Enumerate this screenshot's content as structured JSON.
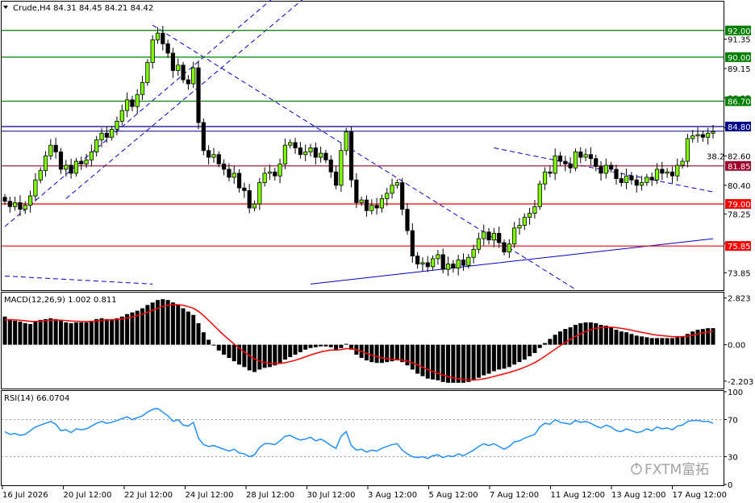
{
  "header": {
    "symbol_line": "Crude,H4  84.31 84.45 84.21 84.42"
  },
  "brand": {
    "logo_text": "FXTM富拓"
  },
  "chart_data": [
    {
      "type": "candlestick",
      "title": "Crude,H4",
      "ohlc_last": {
        "open": 84.31,
        "high": 84.45,
        "low": 84.21,
        "close": 84.42
      },
      "ylim": [
        72.6,
        94.1
      ],
      "y_ticks": [
        "91.35",
        "89.15",
        "86.95",
        "84.72",
        "82.60",
        "80.40",
        "78.25",
        "76.05",
        "73.85"
      ],
      "x_ticks": [
        "16 Jul 2026",
        "20 Jul 12:00",
        "22 Jul 12:00",
        "24 Jul 12:00",
        "28 Jul 12:00",
        "30 Jul 12:00",
        "3 Aug 12:00",
        "5 Aug 12:00",
        "7 Aug 12:00",
        "11 Aug 12:00",
        "13 Aug 12:00",
        "17 Aug 12:00"
      ],
      "horizontal_levels": [
        {
          "label": "92.00",
          "value": 92.0,
          "color": "#008000"
        },
        {
          "label": "90.00",
          "value": 90.0,
          "color": "#008000"
        },
        {
          "label": "86.70",
          "value": 86.7,
          "color": "#008000"
        },
        {
          "label": "84.80",
          "value": 84.8,
          "color": "#00008b"
        },
        {
          "label": "81.85",
          "value": 81.85,
          "color": "#a0002a"
        },
        {
          "label": "79.00",
          "value": 79.0,
          "color": "#ff0000"
        },
        {
          "label": "75.85",
          "value": 75.85,
          "color": "#ff0000"
        }
      ],
      "annotations": [
        "38.2"
      ],
      "closes": [
        79.2,
        78.8,
        79.1,
        78.6,
        78.9,
        79.6,
        80.8,
        81.5,
        82.6,
        83.4,
        82.9,
        81.6,
        81.9,
        81.3,
        82.2,
        82.0,
        82.3,
        82.9,
        83.8,
        84.3,
        84.0,
        84.6,
        85.2,
        86.0,
        86.8,
        86.3,
        87.2,
        88.1,
        89.6,
        91.3,
        91.8,
        91.0,
        90.3,
        89.0,
        89.4,
        88.3,
        88.0,
        89.2,
        85.1,
        83.0,
        82.5,
        82.7,
        82.0,
        81.6,
        81.0,
        81.3,
        80.2,
        80.0,
        78.7,
        79.0,
        80.6,
        81.3,
        81.4,
        81.1,
        82.0,
        83.4,
        83.6,
        83.2,
        82.7,
        82.9,
        83.2,
        82.5,
        82.8,
        82.3,
        81.4,
        80.4,
        83.0,
        84.4,
        80.8,
        79.1,
        79.3,
        78.5,
        78.9,
        78.7,
        79.4,
        79.8,
        80.4,
        80.6,
        78.6,
        77.0,
        75.1,
        74.5,
        74.6,
        74.3,
        74.9,
        75.2,
        74.1,
        74.5,
        74.2,
        74.8,
        74.4,
        75.0,
        75.6,
        76.4,
        76.9,
        76.3,
        76.8,
        76.1,
        75.4,
        76.0,
        77.2,
        77.4,
        78.0,
        78.3,
        78.8,
        80.5,
        81.4,
        81.3,
        82.6,
        82.2,
        82.0,
        81.7,
        82.9,
        82.5,
        82.7,
        82.4,
        81.8,
        81.3,
        81.9,
        81.6,
        80.9,
        80.6,
        81.1,
        80.8,
        80.4,
        80.6,
        81.0,
        80.8,
        81.6,
        81.3,
        81.4,
        81.1,
        81.9,
        82.2,
        83.9,
        84.1,
        84.2,
        84.0,
        84.3,
        84.42
      ]
    },
    {
      "type": "histogram-line",
      "title": "MACD(12,26,9) 1.002 0.811",
      "ylim": [
        -2.6,
        3.1
      ],
      "y_ticks": [
        "2.823",
        "0.00",
        "-2.203"
      ],
      "series": [
        {
          "name": "MACD",
          "values": [
            1.7,
            1.55,
            1.45,
            1.4,
            1.3,
            1.25,
            1.4,
            1.5,
            1.55,
            1.6,
            1.55,
            1.45,
            1.35,
            1.3,
            1.35,
            1.35,
            1.35,
            1.45,
            1.55,
            1.6,
            1.55,
            1.55,
            1.6,
            1.7,
            1.85,
            1.95,
            2.05,
            2.2,
            2.4,
            2.55,
            2.7,
            2.75,
            2.7,
            2.55,
            2.4,
            2.2,
            2.0,
            1.8,
            1.3,
            0.75,
            0.3,
            -0.05,
            -0.35,
            -0.6,
            -0.8,
            -1.0,
            -1.2,
            -1.35,
            -1.55,
            -1.65,
            -1.5,
            -1.4,
            -1.35,
            -1.25,
            -1.1,
            -0.9,
            -0.75,
            -0.6,
            -0.45,
            -0.3,
            -0.2,
            -0.15,
            -0.1,
            -0.1,
            -0.15,
            -0.3,
            -0.2,
            0.05,
            -0.3,
            -0.6,
            -0.8,
            -0.95,
            -1.05,
            -1.1,
            -1.1,
            -1.05,
            -1.0,
            -0.95,
            -1.05,
            -1.25,
            -1.5,
            -1.75,
            -1.9,
            -2.05,
            -2.1,
            -2.15,
            -2.25,
            -2.3,
            -2.3,
            -2.3,
            -2.3,
            -2.25,
            -2.15,
            -2.0,
            -1.85,
            -1.75,
            -1.6,
            -1.5,
            -1.45,
            -1.35,
            -1.2,
            -1.05,
            -0.9,
            -0.7,
            -0.5,
            -0.2,
            0.1,
            0.35,
            0.6,
            0.8,
            0.95,
            1.05,
            1.2,
            1.3,
            1.35,
            1.35,
            1.3,
            1.2,
            1.15,
            1.05,
            0.9,
            0.8,
            0.75,
            0.65,
            0.55,
            0.5,
            0.45,
            0.4,
            0.4,
            0.4,
            0.4,
            0.4,
            0.45,
            0.5,
            0.65,
            0.8,
            0.9,
            0.95,
            1.0,
            1.0
          ]
        },
        {
          "name": "Signal",
          "values": [
            1.5,
            1.51,
            1.5,
            1.48,
            1.45,
            1.41,
            1.41,
            1.42,
            1.45,
            1.48,
            1.49,
            1.48,
            1.46,
            1.43,
            1.42,
            1.41,
            1.4,
            1.41,
            1.44,
            1.47,
            1.49,
            1.5,
            1.52,
            1.56,
            1.62,
            1.68,
            1.76,
            1.85,
            1.96,
            2.08,
            2.2,
            2.31,
            2.39,
            2.42,
            2.42,
            2.38,
            2.3,
            2.2,
            2.02,
            1.76,
            1.47,
            1.17,
            0.86,
            0.57,
            0.3,
            0.04,
            -0.21,
            -0.44,
            -0.66,
            -0.86,
            -0.99,
            -1.07,
            -1.13,
            -1.15,
            -1.14,
            -1.09,
            -1.02,
            -0.94,
            -0.84,
            -0.73,
            -0.62,
            -0.53,
            -0.44,
            -0.37,
            -0.32,
            -0.32,
            -0.3,
            -0.23,
            -0.24,
            -0.31,
            -0.41,
            -0.52,
            -0.63,
            -0.72,
            -0.8,
            -0.85,
            -0.88,
            -0.9,
            -0.93,
            -0.99,
            -1.09,
            -1.22,
            -1.36,
            -1.5,
            -1.62,
            -1.73,
            -1.83,
            -1.93,
            -2.0,
            -2.06,
            -2.11,
            -2.14,
            -2.14,
            -2.11,
            -2.06,
            -2.0,
            -1.92,
            -1.84,
            -1.76,
            -1.68,
            -1.58,
            -1.48,
            -1.36,
            -1.23,
            -1.08,
            -0.9,
            -0.7,
            -0.49,
            -0.27,
            -0.06,
            0.14,
            0.32,
            0.5,
            0.66,
            0.8,
            0.91,
            0.99,
            1.03,
            1.06,
            1.06,
            1.03,
            0.99,
            0.94,
            0.88,
            0.81,
            0.75,
            0.69,
            0.63,
            0.58,
            0.55,
            0.52,
            0.49,
            0.49,
            0.49,
            0.52,
            0.58,
            0.64,
            0.71,
            0.77,
            0.81
          ]
        }
      ]
    },
    {
      "type": "line",
      "title": "RSI(14) 66.0704",
      "ylim": [
        0,
        100
      ],
      "y_ticks": [
        "100",
        "70",
        "30",
        "0"
      ],
      "series": [
        {
          "values": [
            57,
            54,
            55,
            53,
            54,
            58,
            62,
            64,
            66,
            68,
            65,
            58,
            59,
            56,
            60,
            59,
            60,
            63,
            66,
            68,
            66,
            67,
            69,
            71,
            73,
            70,
            72,
            74,
            78,
            81,
            82,
            78,
            74,
            68,
            70,
            64,
            63,
            67,
            50,
            43,
            41,
            42,
            40,
            38,
            36,
            38,
            34,
            33,
            30,
            32,
            40,
            44,
            44,
            43,
            47,
            52,
            53,
            50,
            48,
            49,
            51,
            47,
            49,
            46,
            42,
            39,
            52,
            57,
            42,
            37,
            38,
            35,
            37,
            36,
            39,
            41,
            43,
            44,
            37,
            33,
            30,
            29,
            30,
            28,
            31,
            32,
            29,
            31,
            30,
            33,
            31,
            34,
            37,
            41,
            44,
            42,
            44,
            41,
            38,
            41,
            46,
            47,
            50,
            52,
            54,
            62,
            66,
            65,
            70,
            67,
            66,
            65,
            69,
            67,
            68,
            66,
            63,
            61,
            64,
            62,
            58,
            57,
            60,
            58,
            56,
            57,
            60,
            58,
            62,
            60,
            61,
            59,
            63,
            64,
            68,
            69,
            69,
            68,
            68,
            66
          ]
        }
      ]
    }
  ]
}
